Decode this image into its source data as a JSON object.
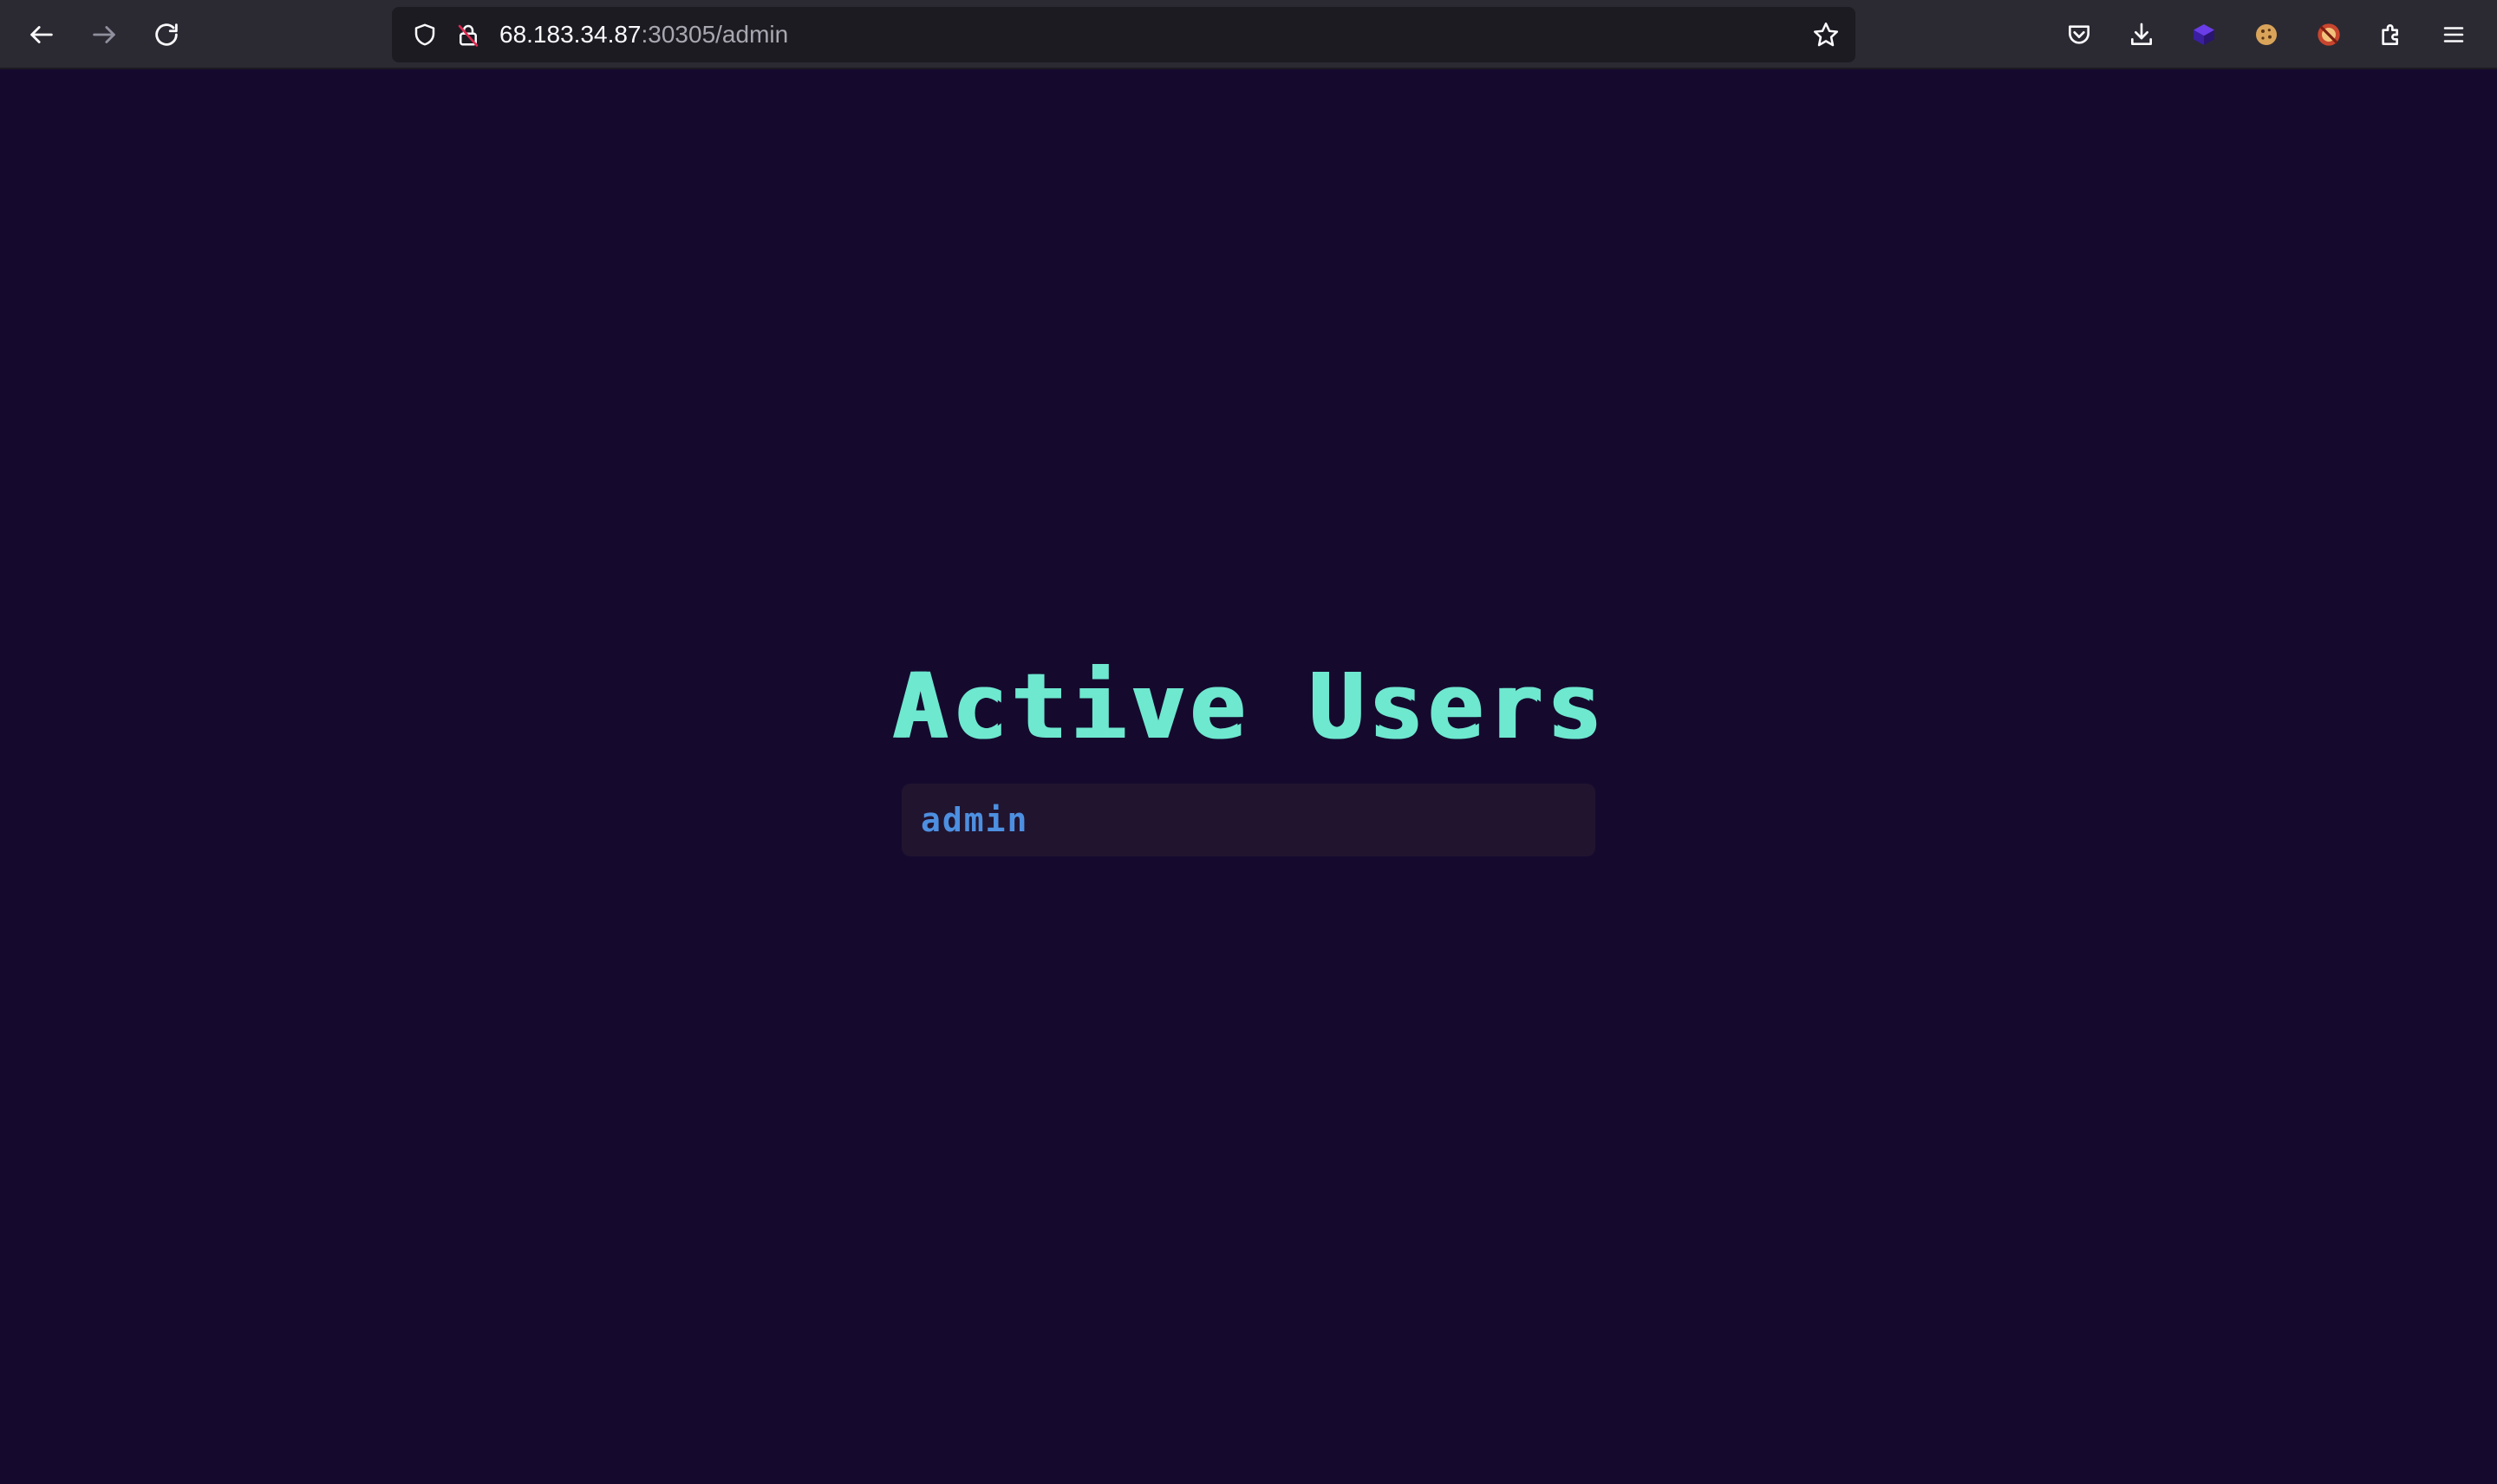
{
  "browser": {
    "url_host": "68.183.34.87",
    "url_rest": ":30305/admin",
    "icons": {
      "back": "arrow-left-icon",
      "forward": "arrow-right-icon",
      "reload": "reload-icon",
      "tracking": "shield-icon",
      "insecure": "broken-lock-icon",
      "bookmark": "star-icon",
      "pocket": "pocket-icon",
      "downloads": "download-icon",
      "ext1": "purple-cube-extension-icon",
      "ext2": "cookie-extension-icon",
      "ext3": "badge-extension-icon",
      "extensions": "puzzle-icon",
      "menu": "hamburger-menu-icon"
    }
  },
  "page": {
    "title": "Active Users",
    "users": [
      "admin"
    ]
  },
  "colors": {
    "background": "#150a2e",
    "title": "#6ee8cf",
    "card": "#21142f",
    "username": "#4d8fe0",
    "toolbar": "#2b2a33",
    "urlbar": "#1c1b22"
  }
}
